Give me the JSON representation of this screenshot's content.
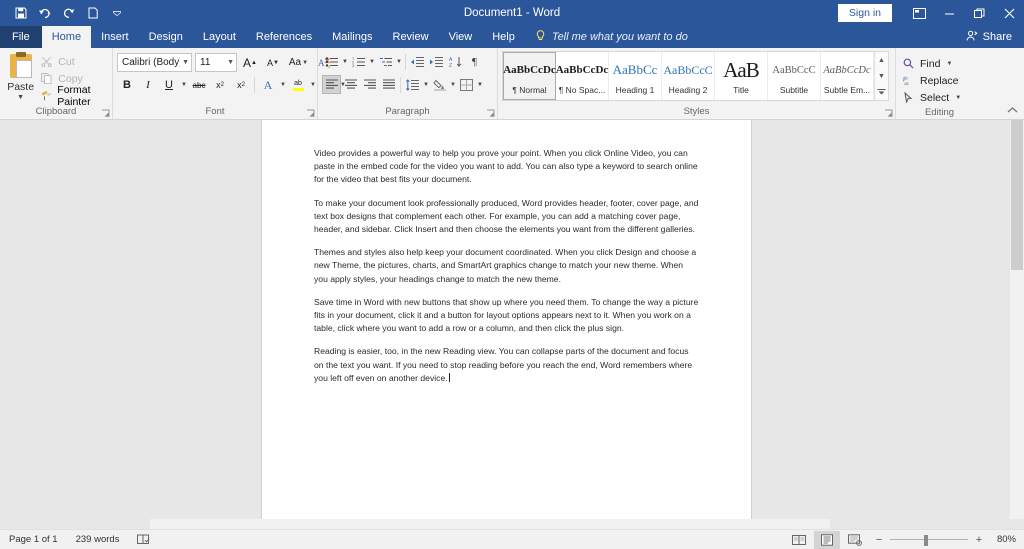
{
  "titlebar": {
    "document_title": "Document1  -  Word",
    "sign_in_label": "Sign in",
    "qat": [
      {
        "name": "save-icon",
        "label": "Save"
      },
      {
        "name": "undo-icon",
        "label": "Undo"
      },
      {
        "name": "redo-icon",
        "label": "Redo"
      },
      {
        "name": "touch-mode-icon",
        "label": "Touch/Mouse Mode"
      },
      {
        "name": "customize-qat-icon",
        "label": "Customize Quick Access Toolbar"
      }
    ],
    "window_controls": [
      {
        "name": "ribbon-display-options",
        "glyph": "⬒"
      },
      {
        "name": "minimize",
        "glyph": "─"
      },
      {
        "name": "restore",
        "glyph": "❐"
      },
      {
        "name": "close",
        "glyph": "✕"
      }
    ]
  },
  "tabs": [
    {
      "label": "File",
      "active": false,
      "file": true
    },
    {
      "label": "Home",
      "active": true,
      "file": false
    },
    {
      "label": "Insert",
      "active": false,
      "file": false
    },
    {
      "label": "Design",
      "active": false,
      "file": false
    },
    {
      "label": "Layout",
      "active": false,
      "file": false
    },
    {
      "label": "References",
      "active": false,
      "file": false
    },
    {
      "label": "Mailings",
      "active": false,
      "file": false
    },
    {
      "label": "Review",
      "active": false,
      "file": false
    },
    {
      "label": "View",
      "active": false,
      "file": false
    },
    {
      "label": "Help",
      "active": false,
      "file": false
    }
  ],
  "tellme": {
    "placeholder": "Tell me what you want to do"
  },
  "share": {
    "label": "Share"
  },
  "ribbon": {
    "clipboard": {
      "group_label": "Clipboard",
      "paste_label": "Paste",
      "commands": [
        {
          "label": "Cut",
          "icon": "scissors-icon",
          "disabled": true
        },
        {
          "label": "Copy",
          "icon": "copy-icon",
          "disabled": true
        },
        {
          "label": "Format Painter",
          "icon": "format-painter-icon",
          "disabled": false
        }
      ]
    },
    "font": {
      "group_label": "Font",
      "font_name": "Calibri (Body)",
      "font_size": "11",
      "row1": [
        {
          "label": "A",
          "name": "grow-font-button"
        },
        {
          "label": "A",
          "name": "shrink-font-button"
        },
        {
          "label": "Aa",
          "name": "change-case-button"
        },
        {
          "label": "",
          "name": "clear-formatting-button"
        }
      ],
      "row2": [
        {
          "label": "B",
          "name": "bold-button"
        },
        {
          "label": "I",
          "name": "italic-button"
        },
        {
          "label": "U",
          "name": "underline-button"
        },
        {
          "label": "abc",
          "name": "strikethrough-button"
        },
        {
          "label": "x₂",
          "name": "subscript-button"
        },
        {
          "label": "x²",
          "name": "superscript-button"
        },
        {
          "label": "A",
          "name": "text-effects-button"
        },
        {
          "label": "ab",
          "name": "text-highlight-color-button"
        },
        {
          "label": "A",
          "name": "font-color-button"
        }
      ],
      "highlight_color": "#ffff00",
      "font_color": "#c00000"
    },
    "paragraph": {
      "group_label": "Paragraph",
      "row1": [
        {
          "name": "bullets-button"
        },
        {
          "name": "numbering-button"
        },
        {
          "name": "multilevel-list-button"
        },
        {
          "name": "decrease-indent-button"
        },
        {
          "name": "increase-indent-button"
        },
        {
          "name": "sort-button"
        },
        {
          "name": "show-formatting-marks-button"
        }
      ],
      "row2": [
        {
          "name": "align-left-button",
          "selected": true
        },
        {
          "name": "align-center-button",
          "selected": false
        },
        {
          "name": "align-right-button",
          "selected": false
        },
        {
          "name": "justify-button",
          "selected": false
        },
        {
          "name": "line-spacing-button",
          "selected": false
        },
        {
          "name": "shading-button",
          "selected": false
        },
        {
          "name": "borders-button",
          "selected": false
        }
      ]
    },
    "styles": {
      "group_label": "Styles",
      "items": [
        {
          "preview": "AaBbCcDc",
          "name": "¶ Normal",
          "kind": "normal",
          "selected": true
        },
        {
          "preview": "AaBbCcDc",
          "name": "¶ No Spac...",
          "kind": "normal",
          "selected": false
        },
        {
          "preview": "AaBbCc",
          "name": "Heading 1",
          "kind": "h1",
          "selected": false
        },
        {
          "preview": "AaBbCcC",
          "name": "Heading 2",
          "kind": "h2",
          "selected": false
        },
        {
          "preview": "AaB",
          "name": "Title",
          "kind": "title",
          "selected": false
        },
        {
          "preview": "AaBbCcC",
          "name": "Subtitle",
          "kind": "sub",
          "selected": false
        },
        {
          "preview": "AaBbCcDc",
          "name": "Subtle Em...",
          "kind": "subem",
          "selected": false
        }
      ],
      "scroll_up": "▲",
      "scroll_down": "▼",
      "more": "▾"
    },
    "editing": {
      "group_label": "Editing",
      "commands": [
        {
          "label": "Find",
          "icon": "magnifier-icon",
          "caret": true
        },
        {
          "label": "Replace",
          "icon": "replace-icon",
          "caret": false
        },
        {
          "label": "Select",
          "icon": "select-cursor-icon",
          "caret": true
        }
      ]
    },
    "collapse_ribbon": "˄"
  },
  "document": {
    "paragraphs": [
      "Video provides a powerful way to help you prove your point. When you click Online Video, you can paste in the embed code for the video you want to add. You can also type a keyword to search online for the video that best fits your document.",
      "To make your document look professionally produced, Word provides header, footer, cover page, and text box designs that complement each other. For example, you can add a matching cover page, header, and sidebar. Click Insert and then choose the elements you want from the different galleries.",
      "Themes and styles also help keep your document coordinated. When you click Design and choose a new Theme, the pictures, charts, and SmartArt graphics change to match your new theme. When you apply styles, your headings change to match the new theme.",
      "Save time in Word with new buttons that show up where you need them. To change the way a picture fits in your document, click it and a button for layout options appears next to it. When you work on a table, click where you want to add a row or a column, and then click the plus sign.",
      "Reading is easier, too, in the new Reading view. You can collapse parts of the document and focus on the text you want. If you need to stop reading before you reach the end, Word remembers where you left off   even on another device."
    ]
  },
  "statusbar": {
    "page_info": "Page 1 of 1",
    "word_count": "239 words",
    "proofing_icon": "proofing-errors-icon",
    "views": [
      {
        "name": "read-mode-button",
        "selected": false
      },
      {
        "name": "print-layout-button",
        "selected": true
      },
      {
        "name": "web-layout-button",
        "selected": false
      }
    ],
    "zoom_out": "−",
    "zoom_in": "+",
    "zoom_level": "80%"
  }
}
